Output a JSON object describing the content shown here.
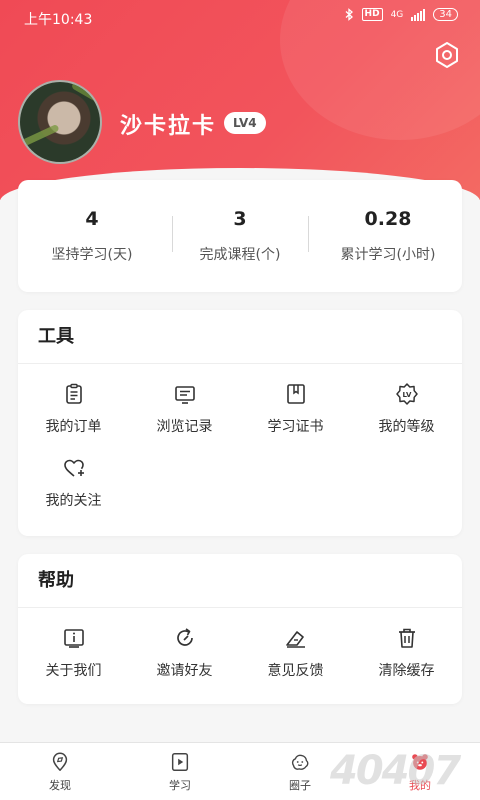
{
  "status_bar": {
    "time": "上午10:43",
    "hd": "HD",
    "network": "4G",
    "battery": "34"
  },
  "profile": {
    "username": "沙卡拉卡",
    "level": "LV4"
  },
  "stats": [
    {
      "value": "4",
      "label": "坚持学习(天)"
    },
    {
      "value": "3",
      "label": "完成课程(个)"
    },
    {
      "value": "0.28",
      "label": "累计学习(小时)"
    }
  ],
  "tools": {
    "title": "工具",
    "items": [
      {
        "label": "我的订单",
        "icon": "order-icon"
      },
      {
        "label": "浏览记录",
        "icon": "history-icon"
      },
      {
        "label": "学习证书",
        "icon": "certificate-icon"
      },
      {
        "label": "我的等级",
        "icon": "level-icon"
      },
      {
        "label": "我的关注",
        "icon": "follow-icon"
      }
    ]
  },
  "help": {
    "title": "帮助",
    "items": [
      {
        "label": "关于我们",
        "icon": "about-icon"
      },
      {
        "label": "邀请好友",
        "icon": "invite-icon"
      },
      {
        "label": "意见反馈",
        "icon": "feedback-icon"
      },
      {
        "label": "清除缓存",
        "icon": "trash-icon"
      }
    ]
  },
  "bottom_nav": [
    {
      "label": "发现",
      "icon": "discover-icon"
    },
    {
      "label": "学习",
      "icon": "study-icon"
    },
    {
      "label": "圈子",
      "icon": "circle-icon"
    },
    {
      "label": "我的",
      "icon": "profile-icon",
      "active": true
    }
  ],
  "watermark": "40407",
  "colors": {
    "brand_red": "#f04a55",
    "active_nav": "#e94a53",
    "page_bg": "#f6f6f6"
  }
}
